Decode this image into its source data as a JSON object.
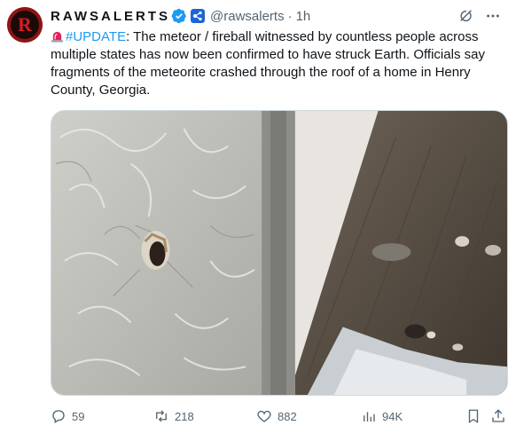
{
  "account": {
    "display_name": "RAWSALERTS",
    "handle": "@rawsalerts",
    "separator": "·",
    "time": "1h",
    "verified_icon": "verified-badge-icon",
    "affiliate_icon": "affiliate-badge-icon",
    "avatar_letter": "R"
  },
  "tweet": {
    "emoji": "rotating-light-icon",
    "hashtag": "#UPDATE",
    "body": ": The meteor / fireball witnessed by countless people across multiple states has now been confirmed to have struck Earth. Officials say fragments of the meteorite crashed through the roof of a home in Henry County, Georgia."
  },
  "actions": {
    "replies": "59",
    "reposts": "218",
    "likes": "882",
    "views": "94K"
  },
  "colors": {
    "accent": "#1d9bf0",
    "muted": "#536471",
    "text": "#0f1419",
    "avatar_bg": "#8e1414"
  }
}
